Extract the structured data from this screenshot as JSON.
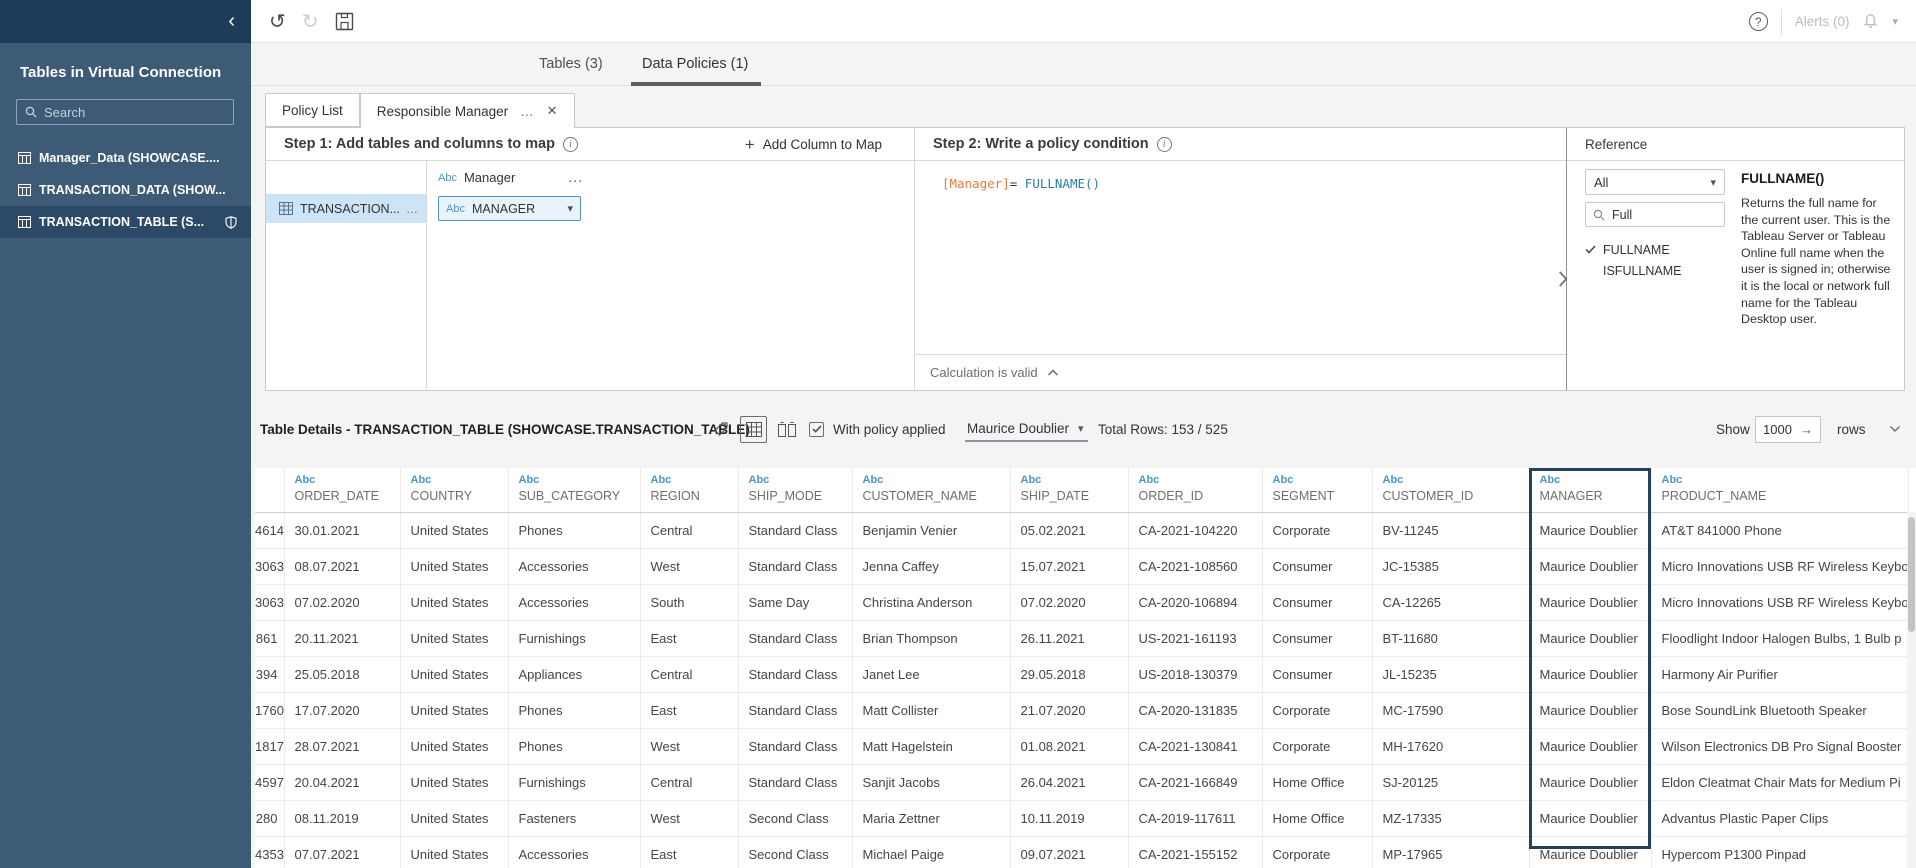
{
  "icons": {
    "undo": "↺",
    "redo": "↻",
    "collapse": "‹",
    "ellipsis": "…",
    "close": "✕",
    "caret_down": "▾",
    "plus": "+",
    "arrow_right": "→",
    "question": "?",
    "info": "i"
  },
  "colors": {
    "sidebar": "#3d5a77",
    "sidebar_header": "#1e3c59",
    "accent_blue": "#4e95c6",
    "selected_item": "#2c4a68",
    "highlight_border": "#24425f",
    "code_field_orange": "#e8793f",
    "code_function_blue": "#2e7cab",
    "mapped_row_blue": "#cde4f6"
  },
  "sidebar": {
    "title": "Tables in Virtual Connection",
    "search_placeholder": "Search",
    "tables": [
      {
        "label": "Manager_Data (SHOWCASE....",
        "selected": false,
        "shield": false
      },
      {
        "label": "TRANSACTION_DATA (SHOW...",
        "selected": false,
        "shield": false
      },
      {
        "label": "TRANSACTION_TABLE (S...",
        "selected": true,
        "shield": true
      }
    ]
  },
  "toolbar": {
    "alerts_label": "Alerts (0)"
  },
  "main_tabs": [
    {
      "label": "Tables (3)",
      "active": false
    },
    {
      "label": "Data Policies (1)",
      "active": true
    }
  ],
  "policy_tabs": [
    {
      "label": "Policy List",
      "active": false
    },
    {
      "label": "Responsible Manager",
      "active": true
    }
  ],
  "step1": {
    "title": "Step 1: Add tables and columns to map",
    "add_column_label": "Add Column to Map",
    "column_header": {
      "type": "Abc",
      "label": "Manager"
    },
    "row": {
      "table_label": "TRANSACTION...",
      "mapped_column": {
        "type": "Abc",
        "label": "MANAGER"
      }
    }
  },
  "step2": {
    "title": "Step 2: Write a policy condition",
    "expression": {
      "field": "[Manager]",
      "operator": "=",
      "function": "FULLNAME()"
    },
    "status": "Calculation is valid"
  },
  "reference": {
    "title": "Reference",
    "filter_value": "All",
    "search_value": "Full",
    "functions": [
      {
        "name": "FULLNAME",
        "checked": true
      },
      {
        "name": "ISFULLNAME",
        "checked": false
      }
    ],
    "detail": {
      "heading": "FULLNAME()",
      "description": "Returns the full name for the current user. This is the Tableau Server or Tableau Online full name when the user is signed in; otherwise it is the local or network full name for the Tableau Desktop user."
    }
  },
  "table_details": {
    "title": "Table Details - TRANSACTION_TABLE (SHOWCASE.TRANSACTION_TABLE)",
    "with_policy_label": "With policy applied",
    "user_dropdown": "Maurice Doublier",
    "total_rows": "Total Rows: 153 / 525",
    "show_label": "Show",
    "show_value": "1000",
    "rows_label": "rows"
  },
  "data_table": {
    "highlight_column": "MANAGER",
    "columns": [
      {
        "type": "",
        "name": ""
      },
      {
        "type": "Abc",
        "name": "ORDER_DATE"
      },
      {
        "type": "Abc",
        "name": "COUNTRY"
      },
      {
        "type": "Abc",
        "name": "SUB_CATEGORY"
      },
      {
        "type": "Abc",
        "name": "REGION"
      },
      {
        "type": "Abc",
        "name": "SHIP_MODE"
      },
      {
        "type": "Abc",
        "name": "CUSTOMER_NAME"
      },
      {
        "type": "Abc",
        "name": "SHIP_DATE"
      },
      {
        "type": "Abc",
        "name": "ORDER_ID"
      },
      {
        "type": "Abc",
        "name": "SEGMENT"
      },
      {
        "type": "Abc",
        "name": "CUSTOMER_ID"
      },
      {
        "type": "Abc",
        "name": "MANAGER"
      },
      {
        "type": "Abc",
        "name": "PRODUCT_NAME"
      }
    ],
    "rows": [
      [
        "4614",
        "30.01.2021",
        "United States",
        "Phones",
        "Central",
        "Standard Class",
        "Benjamin Venier",
        "05.02.2021",
        "CA-2021-104220",
        "Corporate",
        "BV-11245",
        "Maurice Doublier",
        "AT&T 841000 Phone"
      ],
      [
        "3063",
        "08.07.2021",
        "United States",
        "Accessories",
        "West",
        "Standard Class",
        "Jenna Caffey",
        "15.07.2021",
        "CA-2021-108560",
        "Consumer",
        "JC-15385",
        "Maurice Doublier",
        "Micro Innovations USB RF Wireless Keybo"
      ],
      [
        "3063",
        "07.02.2020",
        "United States",
        "Accessories",
        "South",
        "Same Day",
        "Christina Anderson",
        "07.02.2020",
        "CA-2020-106894",
        "Consumer",
        "CA-12265",
        "Maurice Doublier",
        "Micro Innovations USB RF Wireless Keybo"
      ],
      [
        "861",
        "20.11.2021",
        "United States",
        "Furnishings",
        "East",
        "Standard Class",
        "Brian Thompson",
        "26.11.2021",
        "US-2021-161193",
        "Consumer",
        "BT-11680",
        "Maurice Doublier",
        "Floodlight Indoor Halogen Bulbs, 1 Bulb p"
      ],
      [
        "394",
        "25.05.2018",
        "United States",
        "Appliances",
        "Central",
        "Standard Class",
        "Janet Lee",
        "29.05.2018",
        "US-2018-130379",
        "Consumer",
        "JL-15235",
        "Maurice Doublier",
        "Harmony Air Purifier"
      ],
      [
        "1760",
        "17.07.2020",
        "United States",
        "Phones",
        "East",
        "Standard Class",
        "Matt Collister",
        "21.07.2020",
        "CA-2020-131835",
        "Corporate",
        "MC-17590",
        "Maurice Doublier",
        "Bose SoundLink Bluetooth Speaker"
      ],
      [
        "1817",
        "28.07.2021",
        "United States",
        "Phones",
        "West",
        "Standard Class",
        "Matt Hagelstein",
        "01.08.2021",
        "CA-2021-130841",
        "Corporate",
        "MH-17620",
        "Maurice Doublier",
        "Wilson Electronics DB Pro Signal Booster"
      ],
      [
        "4597",
        "20.04.2021",
        "United States",
        "Furnishings",
        "Central",
        "Standard Class",
        "Sanjit Jacobs",
        "26.04.2021",
        "CA-2021-166849",
        "Home Office",
        "SJ-20125",
        "Maurice Doublier",
        "Eldon Cleatmat Chair Mats for Medium Pi"
      ],
      [
        "280",
        "08.11.2019",
        "United States",
        "Fasteners",
        "West",
        "Second Class",
        "Maria Zettner",
        "10.11.2019",
        "CA-2019-117611",
        "Home Office",
        "MZ-17335",
        "Maurice Doublier",
        "Advantus Plastic Paper Clips"
      ],
      [
        "4353",
        "07.07.2021",
        "United States",
        "Accessories",
        "East",
        "Second Class",
        "Michael Paige",
        "09.07.2021",
        "CA-2021-155152",
        "Corporate",
        "MP-17965",
        "Maurice Doublier",
        "Hypercom P1300 Pinpad"
      ]
    ]
  }
}
